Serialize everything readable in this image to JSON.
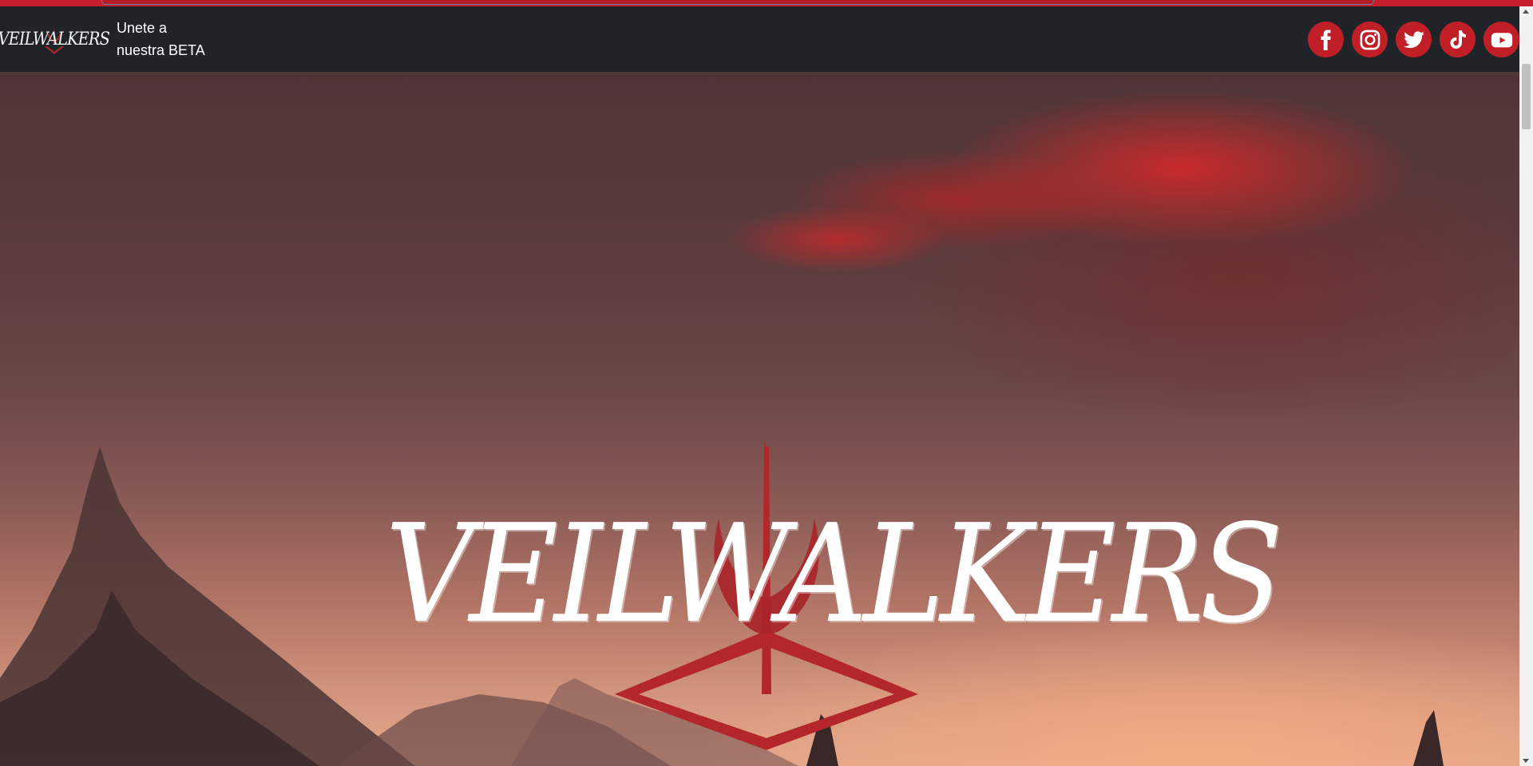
{
  "navbar": {
    "brand_logo_text": "VEILWALKERS",
    "beta_link": "Unete a nuestra BETA",
    "socials": [
      {
        "name": "facebook",
        "icon": "facebook-icon"
      },
      {
        "name": "instagram",
        "icon": "instagram-icon"
      },
      {
        "name": "twitter",
        "icon": "twitter-icon"
      },
      {
        "name": "tiktok",
        "icon": "tiktok-icon"
      },
      {
        "name": "youtube",
        "icon": "youtube-icon"
      }
    ]
  },
  "hero": {
    "title_logo_text": "VEILWALKERS"
  },
  "colors": {
    "brand_red": "#c01f28",
    "navbar_bg": "#202428",
    "top_strip": "#c8202a"
  }
}
